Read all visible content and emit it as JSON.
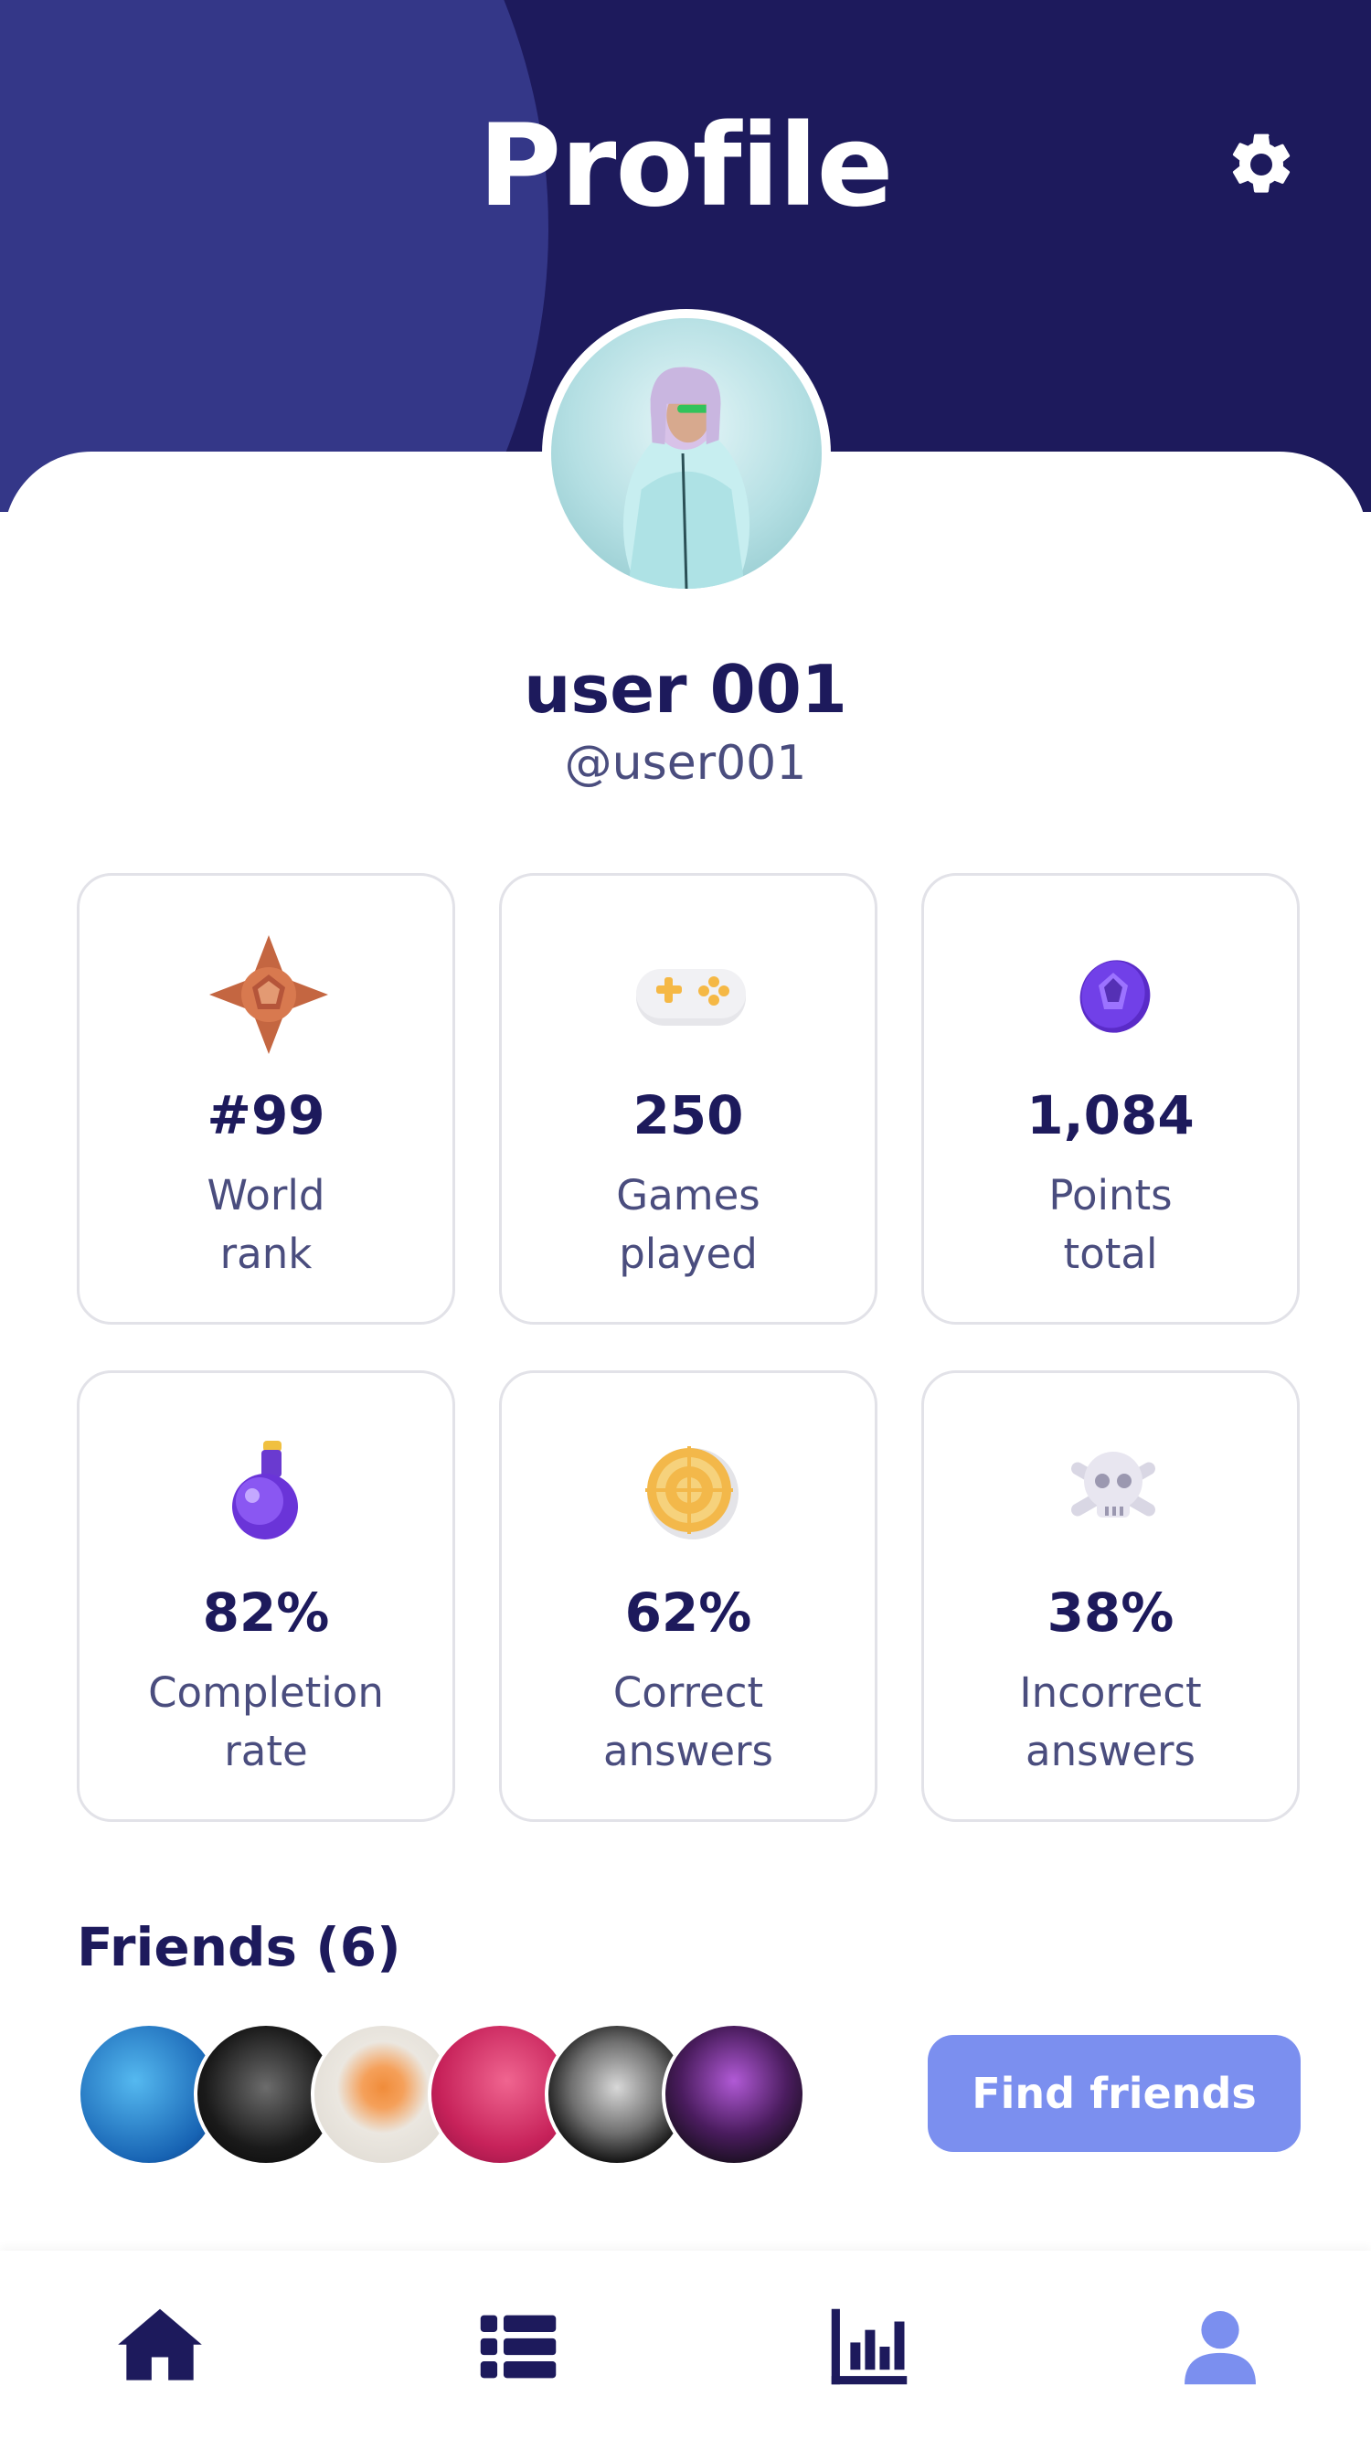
{
  "header": {
    "title": "Profile"
  },
  "profile": {
    "name": "user 001",
    "handle": "@user001"
  },
  "stats": [
    {
      "icon": "medal-icon",
      "value": "#99",
      "label_line1": "World",
      "label_line2": "rank"
    },
    {
      "icon": "gamepad-icon",
      "value": "250",
      "label_line1": "Games",
      "label_line2": "played"
    },
    {
      "icon": "gem-icon",
      "value": "1,084",
      "label_line1": "Points",
      "label_line2": "total"
    },
    {
      "icon": "potion-icon",
      "value": "82%",
      "label_line1": "Completion",
      "label_line2": "rate"
    },
    {
      "icon": "target-icon",
      "value": "62%",
      "label_line1": "Correct",
      "label_line2": "answers"
    },
    {
      "icon": "skull-icon",
      "value": "38%",
      "label_line1": "Incorrect",
      "label_line2": "answers"
    }
  ],
  "friends": {
    "title": "Friends (6)",
    "button_label": "Find friends"
  },
  "nav": {
    "items": [
      "home-icon",
      "list-icon",
      "chart-icon",
      "profile-icon"
    ],
    "active": "profile-icon"
  },
  "colors": {
    "primary": "#1d1a5c",
    "accent": "#7b8fef",
    "header_light": "#343788"
  }
}
